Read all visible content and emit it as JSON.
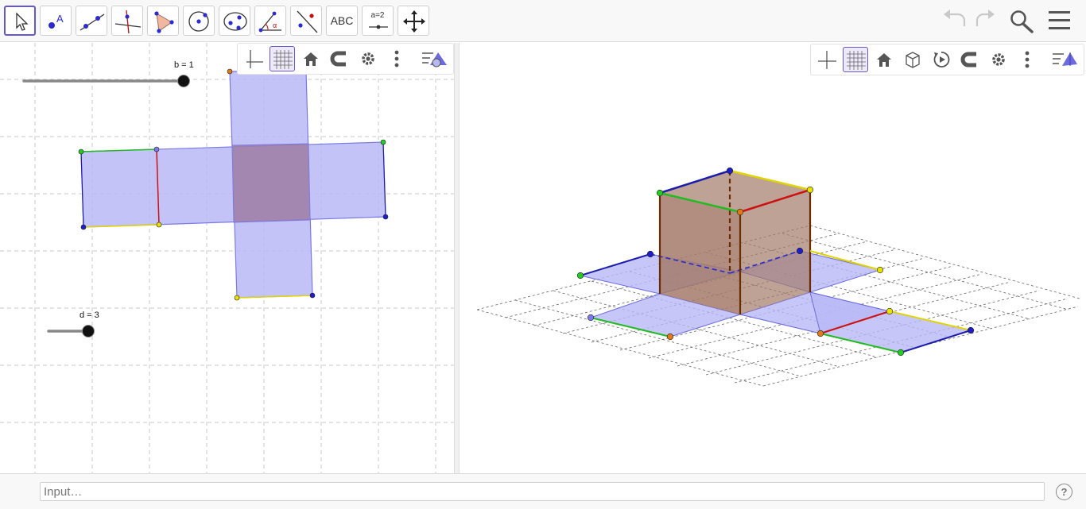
{
  "toolbar": {
    "tools": [
      {
        "name": "move-tool",
        "icon": "cursor-arrow-icon"
      },
      {
        "name": "point-tool",
        "icon": "point-icon",
        "text": "A"
      },
      {
        "name": "line-tool",
        "icon": "line-icon"
      },
      {
        "name": "perpendicular-line-tool",
        "icon": "perpendicular-icon"
      },
      {
        "name": "polygon-tool",
        "icon": "polygon-icon"
      },
      {
        "name": "circle-center-point-tool",
        "icon": "circle-icon"
      },
      {
        "name": "ellipse-tool",
        "icon": "ellipse-icon"
      },
      {
        "name": "angle-tool",
        "icon": "angle-icon",
        "text": "α"
      },
      {
        "name": "reflect-tool",
        "icon": "reflect-icon"
      },
      {
        "name": "text-tool",
        "icon": "text-icon",
        "text": "ABC"
      },
      {
        "name": "slider-tool",
        "icon": "slider-icon",
        "text": "a=2"
      },
      {
        "name": "move-graphics-view-tool",
        "icon": "move-arrows-icon"
      }
    ],
    "right_icons": [
      "undo-icon",
      "redo-icon",
      "search-icon",
      "menu-icon"
    ]
  },
  "view2d": {
    "slider_b": {
      "label": "b = 1",
      "value": 1,
      "fraction": 1.0
    },
    "slider_d": {
      "label": "d = 3",
      "value": 3,
      "fraction": 1.0
    },
    "style_bar": [
      "axes-icon",
      "grid-icon",
      "home-icon",
      "magnet-icon",
      "gear-icon",
      "more-vertical-icon",
      "view-toggle-icon"
    ]
  },
  "view3d": {
    "style_bar": [
      "axes-icon",
      "grid-icon",
      "home-icon",
      "cube-view-icon",
      "rotate-view-icon",
      "magnet-icon",
      "gear-icon",
      "more-vertical-icon",
      "view-toggle-icon"
    ]
  },
  "colors": {
    "accent": "#6557d2",
    "face_fill": "#b8b8f6",
    "overlap_fill": "#9f7ea4",
    "cube_fill": "#a37a6a",
    "edge_blue": "#1d1dab",
    "edge_green": "#22bb22",
    "edge_yellow": "#e0d400",
    "edge_red": "#cc1111",
    "edge_brown": "#6b2c00"
  },
  "input_bar": {
    "placeholder": "Input…"
  },
  "help": {
    "label": "?"
  }
}
